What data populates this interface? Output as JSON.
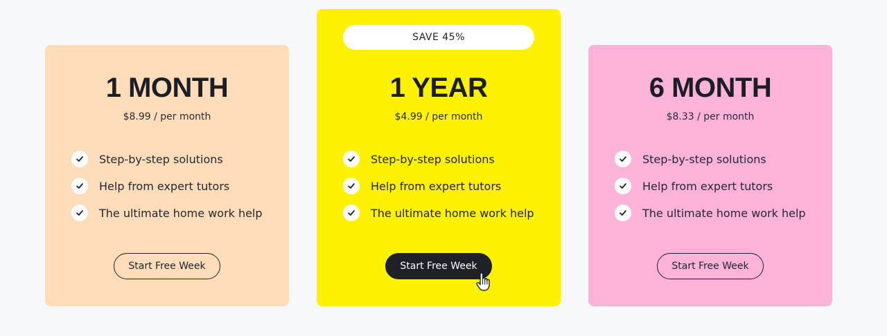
{
  "plans": [
    {
      "title": "1 MONTH",
      "price": "$8.99 / per month",
      "features": [
        "Step-by-step solutions",
        "Help from expert tutors",
        "The ultimate home work help"
      ],
      "cta": "Start Free Week",
      "background": "#ffdcba"
    },
    {
      "badge": "SAVE 45%",
      "title": "1 YEAR",
      "price": "$4.99 / per month",
      "features": [
        "Step-by-step solutions",
        "Help from expert tutors",
        "The ultimate home work help"
      ],
      "cta": "Start Free Week",
      "background": "#fff200",
      "highlighted": true
    },
    {
      "title": "6 MONTH",
      "price": "$8.33 / per month",
      "features": [
        "Step-by-step solutions",
        "Help from expert tutors",
        "The ultimate home work help"
      ],
      "cta": "Start Free Week",
      "background": "#ffb3d8"
    }
  ],
  "icons": {
    "feature": "check-icon",
    "cursor": "hand-pointer-icon"
  },
  "colors": {
    "page_background": "#f7f8fa",
    "text": "#1f2128",
    "button_dark": "#1f2128"
  }
}
